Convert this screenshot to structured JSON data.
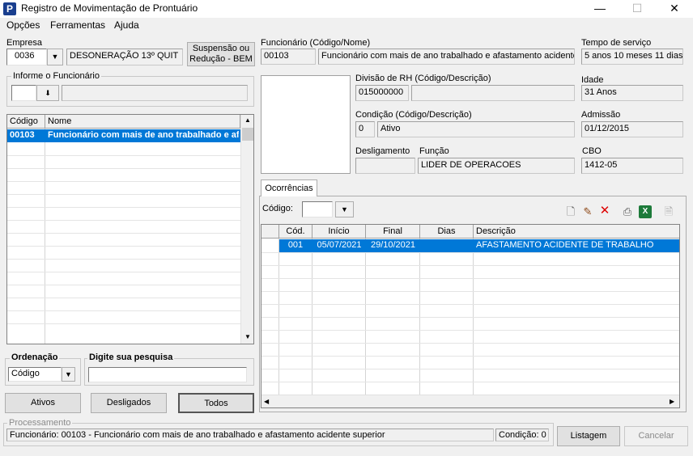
{
  "window": {
    "title": "Registro de Movimentação de Prontuário",
    "app_icon": "P",
    "minimize": "—",
    "maximize": "☐",
    "close": "✕"
  },
  "menu": [
    "Opções",
    "Ferramentas",
    "Ajuda"
  ],
  "empresa": {
    "label": "Empresa",
    "code": "0036",
    "name": "DESONERAÇÃO 13º QUIT"
  },
  "suspensao_button": "Suspensão ou Redução - BEM",
  "informe": {
    "label": "Informe o Funcionário",
    "value": ""
  },
  "employee_list": {
    "headers": [
      "Código",
      "Nome"
    ],
    "selected": {
      "codigo": "00103",
      "nome": "Funcionário com mais de ano trabalhado e afas"
    }
  },
  "ordenacao": {
    "label": "Ordenação",
    "value": "Código"
  },
  "pesquisa": {
    "label": "Digite sua pesquisa",
    "value": ""
  },
  "filter_buttons": [
    "Ativos",
    "Desligados",
    "Todos"
  ],
  "funcionario": {
    "label": "Funcionário (Código/Nome)",
    "code": "00103",
    "name": "Funcionário com mais de ano trabalhado e afastamento acidente"
  },
  "tempo_servico": {
    "label": "Tempo de serviço",
    "value": "5 anos 10 meses 11 dias"
  },
  "divisao": {
    "label": "Divisão de RH (Código/Descrição)",
    "code": "015000000",
    "desc": ""
  },
  "idade": {
    "label": "Idade",
    "value": "31 Anos"
  },
  "condicao": {
    "label": "Condição (Código/Descrição)",
    "code": "0",
    "desc": "Ativo"
  },
  "admissao": {
    "label": "Admissão",
    "value": "01/12/2015"
  },
  "desligamento": {
    "label": "Desligamento",
    "value": ""
  },
  "funcao": {
    "label": "Função",
    "value": "LIDER DE OPERACOES"
  },
  "cbo": {
    "label": "CBO",
    "value": "1412-05"
  },
  "ocorrencias": {
    "tab_label": "Ocorrências",
    "codigo_label": "Código:",
    "codigo_value": "",
    "headers": [
      "Cód.",
      "Início",
      "Final",
      "Dias",
      "Descrição"
    ],
    "rows": [
      {
        "cod": "001",
        "inicio": "05/07/2021",
        "final": "29/10/2021",
        "dias": "",
        "descricao": "AFASTAMENTO ACIDENTE DE TRABALHO"
      }
    ]
  },
  "processamento": {
    "label": "Processamento",
    "status": "Funcionário: 00103 - Funcionário com mais de ano trabalhado e afastamento acidente superior",
    "condicao": "Condição: 0"
  },
  "listagem_button": "Listagem",
  "cancelar_button": "Cancelar",
  "colors": {
    "selection": "#0078d7",
    "titlebar": "#ffffff"
  }
}
